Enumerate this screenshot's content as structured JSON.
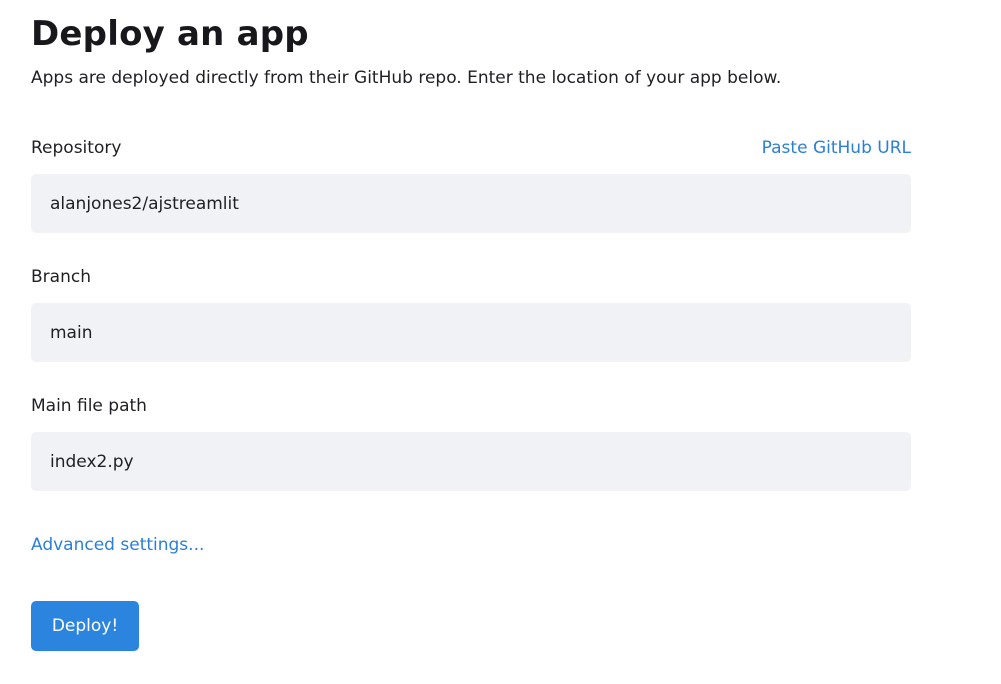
{
  "header": {
    "title": "Deploy an app",
    "subtitle": "Apps are deployed directly from their GitHub repo. Enter the location of your app below."
  },
  "form": {
    "repository": {
      "label": "Repository",
      "value": "alanjones2/ajstreamlit",
      "paste_link": "Paste GitHub URL"
    },
    "branch": {
      "label": "Branch",
      "value": "main"
    },
    "main_file": {
      "label": "Main file path",
      "value": "index2.py"
    },
    "advanced_link": "Advanced settings...",
    "deploy_label": "Deploy!"
  },
  "colors": {
    "accent": "#2b85de",
    "link": "#2b7fd6",
    "input_background": "#f1f2f5"
  }
}
